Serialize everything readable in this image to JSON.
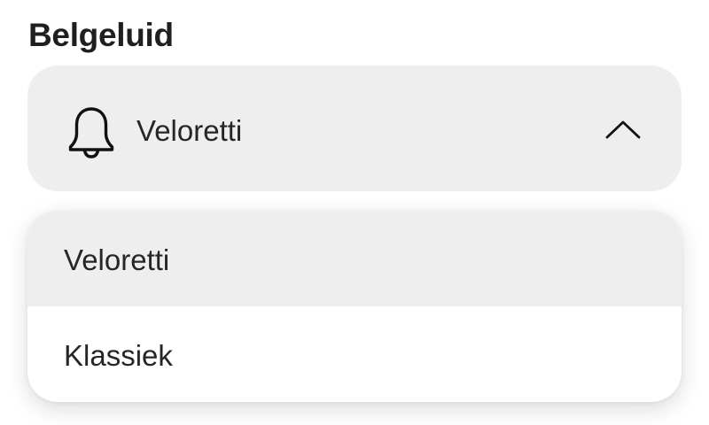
{
  "section": {
    "title": "Belgeluid"
  },
  "select": {
    "icon": "bell-icon",
    "value": "Veloretti",
    "expanded": true,
    "chevron_icon": "chevron-up-icon"
  },
  "dropdown": {
    "options": [
      {
        "label": "Veloretti",
        "selected": true
      },
      {
        "label": "Klassiek",
        "selected": false
      }
    ]
  },
  "colors": {
    "field_background": "#eeeeee",
    "selected_option_background": "#eeeeee",
    "menu_background": "#ffffff",
    "text": "#262626",
    "title": "#1f1f1f"
  }
}
